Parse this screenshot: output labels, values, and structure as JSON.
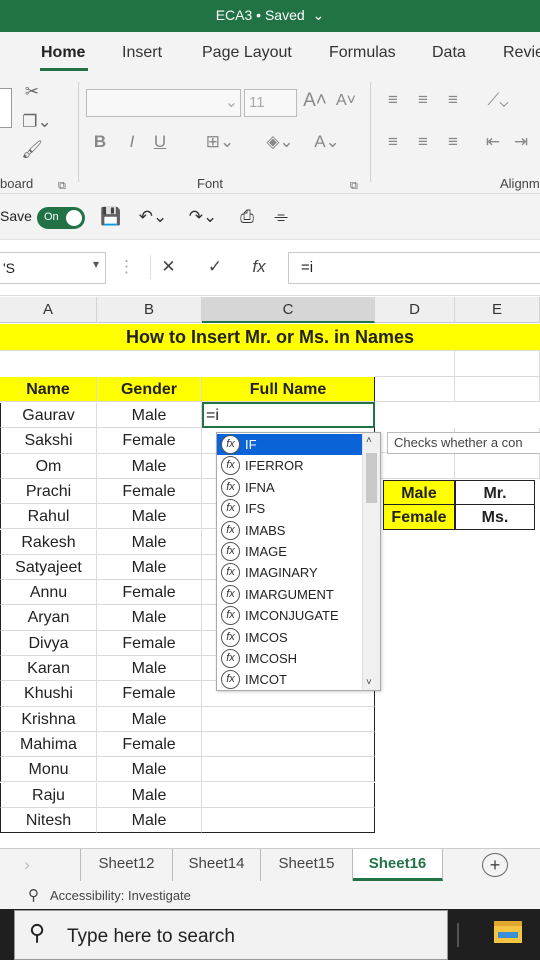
{
  "title": {
    "text": "ECA3 • Saved",
    "chevron": "⌄"
  },
  "tabs": [
    "Home",
    "Insert",
    "Page Layout",
    "Formulas",
    "Data",
    "Revie"
  ],
  "ribbon": {
    "clipboard_label": "board",
    "font_label": "Font",
    "align_label": "Alignm",
    "font_size": "11",
    "bold": "B",
    "italic": "I",
    "underline": "U"
  },
  "qat": {
    "autosave_label": "Save",
    "toggle": "On"
  },
  "formula_bar": {
    "name_box": "'S",
    "formula": "=i",
    "fx": "fx"
  },
  "columns": [
    "A",
    "B",
    "C",
    "D",
    "E"
  ],
  "banner": "How to Insert Mr. or Ms. in Names",
  "headers": {
    "name": "Name",
    "gender": "Gender",
    "full_name": "Full Name"
  },
  "rows": [
    {
      "name": "Gaurav",
      "gender": "Male"
    },
    {
      "name": "Sakshi",
      "gender": "Female"
    },
    {
      "name": "Om",
      "gender": "Male"
    },
    {
      "name": "Prachi",
      "gender": "Female"
    },
    {
      "name": "Rahul",
      "gender": "Male"
    },
    {
      "name": "Rakesh",
      "gender": "Male"
    },
    {
      "name": "Satyajeet",
      "gender": "Male"
    },
    {
      "name": "Annu",
      "gender": "Female"
    },
    {
      "name": "Aryan",
      "gender": "Male"
    },
    {
      "name": "Divya",
      "gender": "Female"
    },
    {
      "name": "Karan",
      "gender": "Male"
    },
    {
      "name": "Khushi",
      "gender": "Female"
    },
    {
      "name": "Krishna",
      "gender": "Male"
    },
    {
      "name": "Mahima",
      "gender": "Female"
    },
    {
      "name": "Monu",
      "gender": "Male"
    },
    {
      "name": "Raju",
      "gender": "Male"
    },
    {
      "name": "Nitesh",
      "gender": "Male"
    }
  ],
  "active_cell_text": "=i",
  "lookup": [
    {
      "gender": "Male",
      "title": "Mr."
    },
    {
      "gender": "Female",
      "title": "Ms."
    }
  ],
  "autocomplete": [
    "IF",
    "IFERROR",
    "IFNA",
    "IFS",
    "IMABS",
    "IMAGE",
    "IMAGINARY",
    "IMARGUMENT",
    "IMCONJUGATE",
    "IMCOS",
    "IMCOSH",
    "IMCOT"
  ],
  "tooltip": "Checks whether a con",
  "sheets": [
    "Sheet12",
    "Sheet14",
    "Sheet15",
    "Sheet16"
  ],
  "status": "Accessibility: Investigate",
  "taskbar": {
    "search_placeholder": "Type here to search"
  },
  "colors": {
    "excel_green": "#217346",
    "highlight": "#ffff00",
    "selection_blue": "#0a64d8"
  }
}
